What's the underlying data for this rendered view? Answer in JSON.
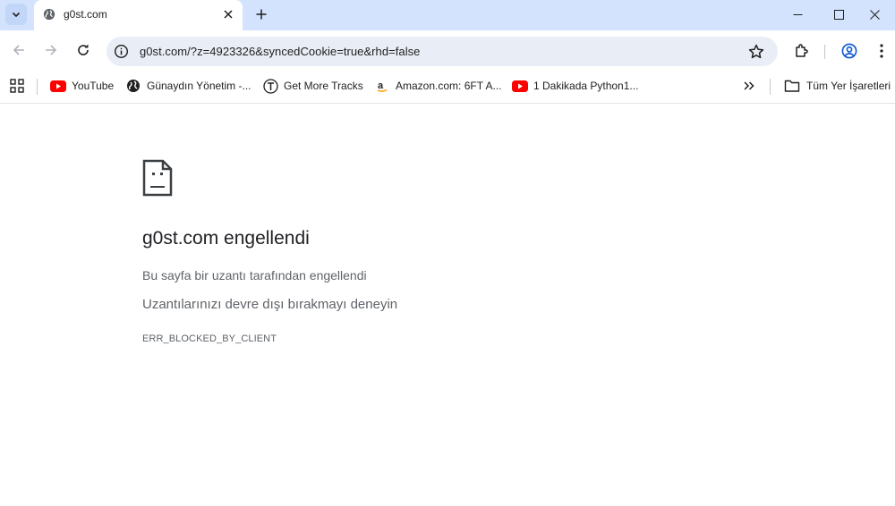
{
  "colors": {
    "tabstrip_bg": "#d3e3fd",
    "omnibox_bg": "#e9eef6",
    "youtube_red": "#ff0000",
    "text_primary": "#1f1f1f",
    "text_secondary": "#5f6368"
  },
  "tab": {
    "title": "g0st.com",
    "favicon": "globe-icon",
    "close_icon": "close-icon"
  },
  "toolbar": {
    "url": "g0st.com/?z=4923326&syncedCookie=true&rhd=false"
  },
  "bookmarks": {
    "items": [
      {
        "label": "YouTube",
        "icon": "youtube-icon"
      },
      {
        "label": "Günaydın Yönetim -...",
        "icon": "globe-icon"
      },
      {
        "label": "Get More Tracks",
        "icon": "tracks-icon"
      },
      {
        "label": "Amazon.com: 6FT A...",
        "icon": "amazon-icon"
      },
      {
        "label": "1 Dakikada Python1...",
        "icon": "youtube-icon"
      }
    ],
    "all_bookmarks": "Tüm Yer İşaretleri"
  },
  "error": {
    "title": "g0st.com engellendi",
    "description": "Bu sayfa bir uzantı tarafından engellendi",
    "suggestion": "Uzantılarınızı devre dışı bırakmayı deneyin",
    "code": "ERR_BLOCKED_BY_CLIENT"
  }
}
